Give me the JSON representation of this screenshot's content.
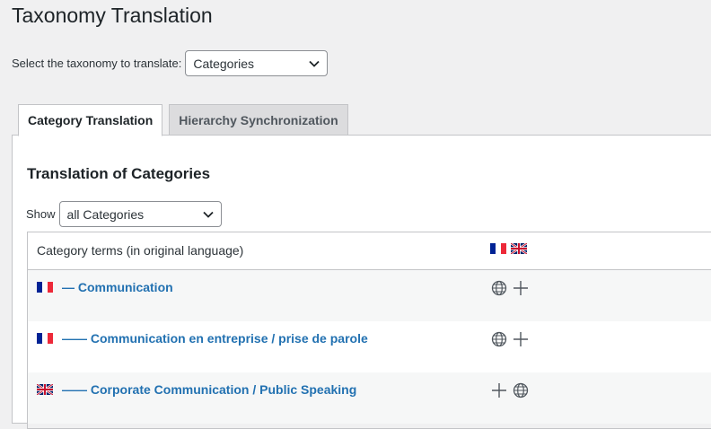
{
  "page": {
    "title": "Taxonomy Translation"
  },
  "taxonomy_select": {
    "label": "Select the taxonomy to translate:",
    "value": "Categories"
  },
  "tabs": [
    {
      "label": "Category Translation",
      "active": true
    },
    {
      "label": "Hierarchy Synchronization",
      "active": false
    }
  ],
  "section": {
    "title": "Translation of Categories"
  },
  "show_filter": {
    "label": "Show",
    "value": "all Categories"
  },
  "table": {
    "header": {
      "title": "Category terms (in original language)",
      "language_flags": [
        "flag-fr-icon",
        "flag-uk-icon"
      ]
    },
    "rows": [
      {
        "flag": "flag-fr-icon",
        "label": "— Communication",
        "actions": [
          "globe-icon",
          "plus-icon"
        ]
      },
      {
        "flag": "flag-fr-icon",
        "label": "—— Communication en entreprise / prise de parole",
        "actions": [
          "globe-icon",
          "plus-icon"
        ]
      },
      {
        "flag": "flag-uk-icon",
        "label": "—— Corporate Communication / Public Speaking",
        "actions": [
          "plus-icon",
          "globe-icon"
        ]
      }
    ]
  },
  "colors": {
    "link": "#2271b1",
    "background": "#f0f0f1",
    "border": "#c3c4c7",
    "icon": "#50575e"
  }
}
